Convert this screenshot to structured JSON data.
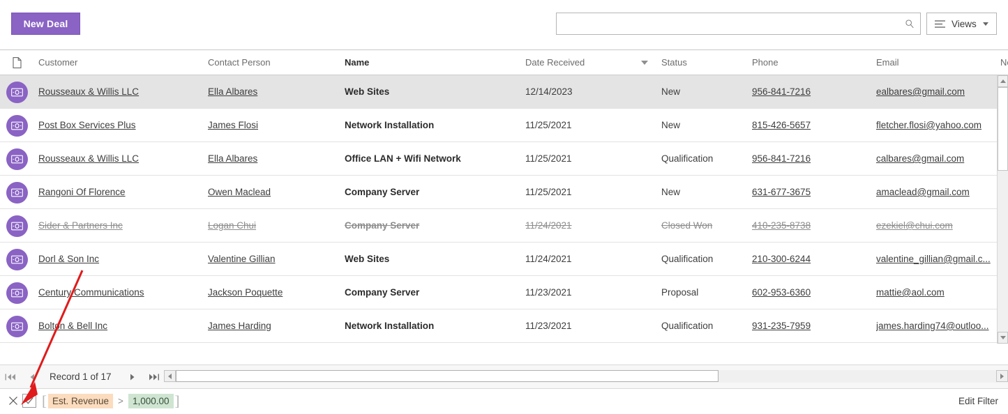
{
  "toolbar": {
    "new_deal_label": "New Deal",
    "search_value": "",
    "search_placeholder": "",
    "views_label": "Views"
  },
  "grid": {
    "columns": [
      {
        "key": "icon",
        "label": ""
      },
      {
        "key": "customer",
        "label": "Customer"
      },
      {
        "key": "contact",
        "label": "Contact Person"
      },
      {
        "key": "name",
        "label": "Name"
      },
      {
        "key": "date",
        "label": "Date Received",
        "sorted": "desc"
      },
      {
        "key": "status",
        "label": "Status"
      },
      {
        "key": "phone",
        "label": "Phone"
      },
      {
        "key": "email",
        "label": "Email"
      },
      {
        "key": "next",
        "label": "Ne"
      }
    ],
    "rows": [
      {
        "customer": "Rousseaux & Willis LLC",
        "contact": "Ella Albares",
        "name": "Web Sites",
        "date": "12/14/2023",
        "status": "New",
        "phone": "956-841-7216",
        "email": "ealbares@gmail.com",
        "selected": true,
        "closed": false
      },
      {
        "customer": "Post Box Services Plus",
        "contact": "James Flosi",
        "name": "Network Installation",
        "date": "11/25/2021",
        "status": "New",
        "phone": "815-426-5657",
        "email": "fletcher.flosi@yahoo.com",
        "selected": false,
        "closed": false
      },
      {
        "customer": "Rousseaux & Willis LLC",
        "contact": "Ella Albares",
        "name": "Office LAN + Wifi Network",
        "date": "11/25/2021",
        "status": "Qualification",
        "phone": "956-841-7216",
        "email": "calbares@gmail.com",
        "selected": false,
        "closed": false
      },
      {
        "customer": "Rangoni Of Florence",
        "contact": "Owen Maclead",
        "name": "Company Server",
        "date": "11/25/2021",
        "status": "New",
        "phone": "631-677-3675",
        "email": "amaclead@gmail.com",
        "selected": false,
        "closed": false
      },
      {
        "customer": "Sider & Partners Inc",
        "contact": "Logan Chui",
        "name": "Company Server",
        "date": "11/24/2021",
        "status": "Closed Won",
        "phone": "410-235-8738",
        "email": "ezekiel@chui.com",
        "selected": false,
        "closed": true
      },
      {
        "customer": "Dorl & Son Inc",
        "contact": "Valentine Gillian",
        "name": "Web Sites",
        "date": "11/24/2021",
        "status": "Qualification",
        "phone": "210-300-6244",
        "email": "valentine_gillian@gmail.c...",
        "selected": false,
        "closed": false
      },
      {
        "customer": "Century Communications",
        "contact": "Jackson Poquette",
        "name": "Company Server",
        "date": "11/23/2021",
        "status": "Proposal",
        "phone": "602-953-6360",
        "email": "mattie@aol.com",
        "selected": false,
        "closed": false
      },
      {
        "customer": "Bolton & Bell Inc",
        "contact": "James Harding",
        "name": "Network Installation",
        "date": "11/23/2021",
        "status": "Qualification",
        "phone": "931-235-7959",
        "email": "james.harding74@outloo...",
        "selected": false,
        "closed": false
      }
    ]
  },
  "statusbar": {
    "record_label": "Record 1 of 17"
  },
  "filterbar": {
    "field": "Est. Revenue",
    "operator": ">",
    "value": "1,000.00",
    "edit_filter_label": "Edit Filter"
  },
  "colors": {
    "accent_purple": "#8a63c4",
    "selected_row": "#e4e4e4",
    "filter_field_bg": "#fbdcbe",
    "filter_value_bg": "#cfe5d2",
    "annotation_red": "#e01b1b"
  }
}
